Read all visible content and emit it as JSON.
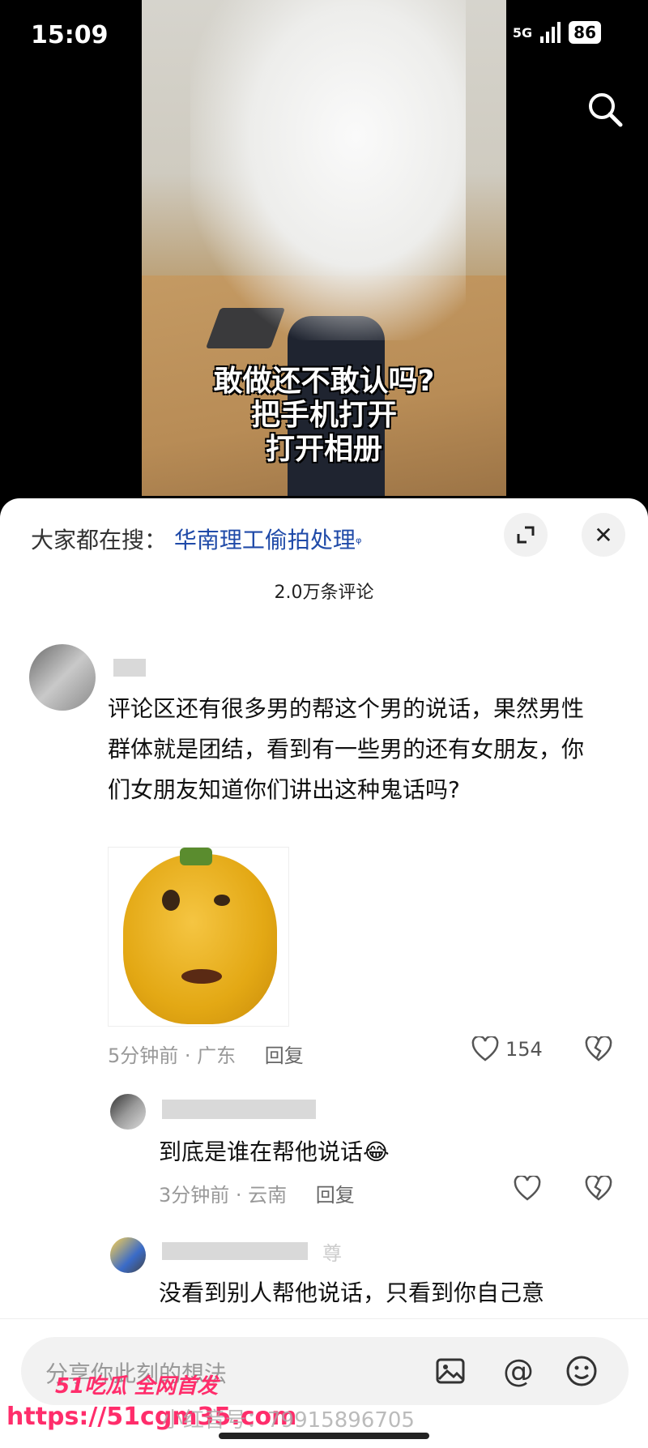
{
  "status": {
    "time": "15:09",
    "net1": "5G",
    "net2": "5G",
    "battery": "86"
  },
  "video": {
    "caption_lines": [
      "敢做还不敢认吗?",
      "把手机打开",
      "打开相册"
    ]
  },
  "sheet": {
    "trending_prefix": "大家都在搜：",
    "trending_keyword": "华南理工偷拍处理",
    "comment_count": "2.0万条评论"
  },
  "comments": [
    {
      "text": "评论区还有很多男的帮这个男的说话，果然男性群体就是团结，看到有一些男的还有女朋友，你们女朋友知道你们讲出这种鬼话吗?",
      "time": "5分钟前 · 广东",
      "reply_label": "回复",
      "likes": "154"
    }
  ],
  "replies": [
    {
      "text": "到底是谁在帮他说话",
      "emoji": "😂",
      "time": "3分钟前 · 云南",
      "reply_label": "回复"
    },
    {
      "text": "没看到别人帮他说话，只看到你自己意",
      "name_tail": "尊"
    }
  ],
  "input": {
    "placeholder": "分享你此刻的想法"
  },
  "watermark": {
    "line1": "51吃瓜 全网首发",
    "line2": "https://51cgm35.com",
    "douyin_id": "小红音号：79915896705"
  },
  "colors": {
    "link": "#1f4aa8",
    "watermark": "#ff2d6b"
  }
}
